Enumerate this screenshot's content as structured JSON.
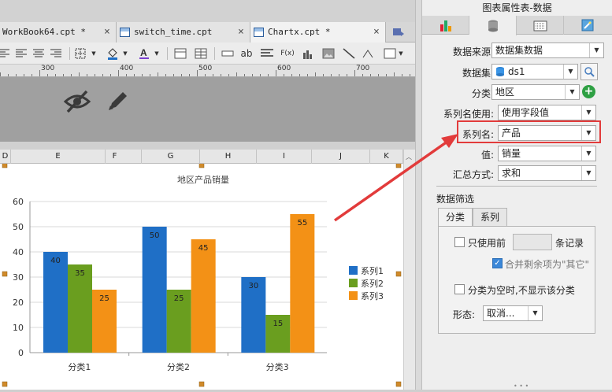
{
  "tabs": [
    {
      "label": "WorkBook64.cpt *"
    },
    {
      "label": "switch_time.cpt"
    },
    {
      "label": "Chartx.cpt *"
    }
  ],
  "tab_close": "×",
  "ruler": {
    "labels": [
      "300",
      "400",
      "500",
      "600",
      "700"
    ]
  },
  "columns": [
    "D",
    "E",
    "F",
    "G",
    "H",
    "I",
    "J",
    "K"
  ],
  "toolbar": {
    "ab": "ab",
    "fx": "F(x)"
  },
  "chart_data": {
    "type": "bar",
    "title": "地区产品销量",
    "categories": [
      "分类1",
      "分类2",
      "分类3"
    ],
    "series": [
      {
        "name": "系列1",
        "color": "#1f6fc6",
        "values": [
          40,
          50,
          30
        ]
      },
      {
        "name": "系列2",
        "color": "#6a9e1f",
        "values": [
          35,
          25,
          15
        ]
      },
      {
        "name": "系列3",
        "color": "#f39116",
        "values": [
          25,
          45,
          55
        ]
      }
    ],
    "ylim": [
      0,
      60
    ],
    "yticks": [
      "0",
      "10",
      "20",
      "30",
      "40",
      "50",
      "60"
    ],
    "legend": "right",
    "grid": true
  },
  "panel": {
    "title": "图表属性表-数据",
    "source_label": "数据来源:",
    "source_value": "数据集数据",
    "dataset_label": "数据集:",
    "dataset_value": "ds1",
    "category_label": "分类:",
    "category_value": "地区",
    "series_use_label": "系列名使用:",
    "series_use_value": "使用字段值",
    "series_name_label": "系列名:",
    "series_name_value": "产品",
    "value_label": "值:",
    "value_value": "销量",
    "summary_label": "汇总方式:",
    "summary_value": "求和",
    "filter_title": "数据筛选",
    "filter_tabs": [
      "分类",
      "系列"
    ],
    "only_use_before": "只使用前",
    "records_suffix": "条记录",
    "merge_rest": "合并剩余项为\"其它\"",
    "hide_empty": "分类为空时,不显示该分类",
    "form_label": "形态:",
    "form_value": "取消..."
  },
  "colors": {
    "accent": "#e23b3b",
    "series1": "#1f6fc6",
    "series2": "#6a9e1f",
    "series3": "#f39116"
  }
}
